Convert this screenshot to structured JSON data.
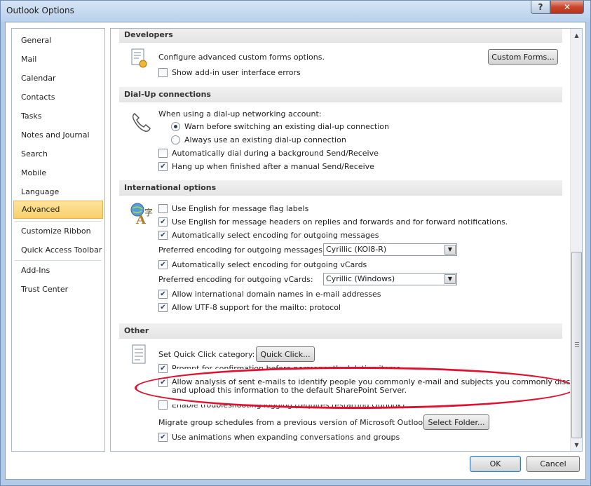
{
  "window": {
    "title": "Outlook Options"
  },
  "nav": {
    "items": [
      {
        "label": "General"
      },
      {
        "label": "Mail"
      },
      {
        "label": "Calendar"
      },
      {
        "label": "Contacts"
      },
      {
        "label": "Tasks"
      },
      {
        "label": "Notes and Journal"
      },
      {
        "label": "Search"
      },
      {
        "label": "Mobile"
      },
      {
        "label": "Language"
      },
      {
        "label": "Advanced"
      },
      {
        "label": "Customize Ribbon"
      },
      {
        "label": "Quick Access Toolbar"
      },
      {
        "label": "Add-Ins"
      },
      {
        "label": "Trust Center"
      }
    ],
    "selected": "Advanced"
  },
  "developers": {
    "header": "Developers",
    "text": "Configure advanced custom forms options.",
    "button": "Custom Forms...",
    "addin_errors": {
      "label": "Show add-in user interface errors",
      "checked": false
    }
  },
  "dialup": {
    "header": "Dial-Up connections",
    "text": "When using a dial-up networking account:",
    "radio_warn": {
      "label": "Warn before switching an existing dial-up connection",
      "selected": true
    },
    "radio_always": {
      "label": "Always use an existing dial-up connection",
      "selected": false
    },
    "auto_dial": {
      "label": "Automatically dial during a background Send/Receive",
      "checked": false
    },
    "hang_up": {
      "label": "Hang up when finished after a manual Send/Receive",
      "checked": true
    }
  },
  "international": {
    "header": "International options",
    "english_flags": {
      "label": "Use English for message flag labels",
      "checked": false
    },
    "english_headers": {
      "label": "Use English for message headers on replies and forwards and for forward notifications.",
      "checked": true
    },
    "auto_encoding": {
      "label": "Automatically select encoding for outgoing messages",
      "checked": true
    },
    "pref_encoding_label": "Preferred encoding for outgoing messages:",
    "pref_encoding_value": "Cyrillic (KOI8-R)",
    "auto_vcard": {
      "label": "Automatically select encoding for outgoing vCards",
      "checked": true
    },
    "pref_vcard_label": "Preferred encoding for outgoing vCards:",
    "pref_vcard_value": "Cyrillic (Windows)",
    "intl_domains": {
      "label": "Allow international domain names in e-mail addresses",
      "checked": true
    },
    "utf8_mailto": {
      "label": "Allow UTF-8 support for the mailto: protocol",
      "checked": true
    }
  },
  "other": {
    "header": "Other",
    "quick_click_label": "Set Quick Click category:",
    "quick_click_button": "Quick Click...",
    "prompt_delete": {
      "label": "Prompt for confirmation before permanently deleting items",
      "checked": true
    },
    "allow_analysis": {
      "label_line1": "Allow analysis of sent e-mails to identify people you commonly e-mail and subjects you commonly discuss,",
      "label_line2": "and upload this information to the default SharePoint Server.",
      "checked": true
    },
    "troubleshoot": {
      "label": "Enable troubleshooting logging (requires restarting Outlook)",
      "checked": false
    },
    "migrate_label": "Migrate group schedules from a previous version of Microsoft Outlook:",
    "select_folder_button": "Select Folder...",
    "animations": {
      "label": "Use animations when expanding conversations and groups",
      "checked": true
    }
  },
  "footer": {
    "ok": "OK",
    "cancel": "Cancel"
  },
  "colors": {
    "annotation": "#e0102e",
    "selected_nav": "#fbd67f"
  }
}
